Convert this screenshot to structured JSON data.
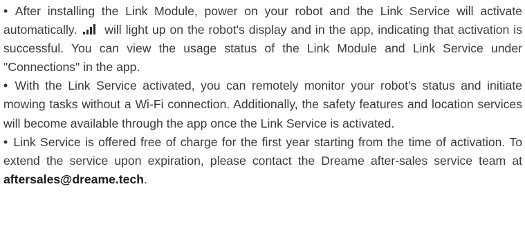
{
  "bullet_char": "•",
  "paragraphs": [
    {
      "text_before_icon": " After installing the Link Module, power on your robot and the Link Service will activate automatically. ",
      "icon": "signal-bars-icon",
      "text_after_icon": " will light up on the robot's display and in the app, indicating that activation is successful. You can view the usage status of the Link Module and Link Service under \"Connections\" in the app."
    },
    {
      "text": " With the Link Service activated, you can remotely monitor your robot's status and initiate mowing tasks without a Wi-Fi connection. Additionally, the safety features and location services will become available through the app once the Link Service is activated."
    },
    {
      "text_before_email": " Link Service is offered free of charge for the first year starting from the time of activation. To extend the service upon expiration, please contact the Dreame after-sales service team at ",
      "email": "aftersales@dreame.tech",
      "text_after_email": "."
    }
  ]
}
